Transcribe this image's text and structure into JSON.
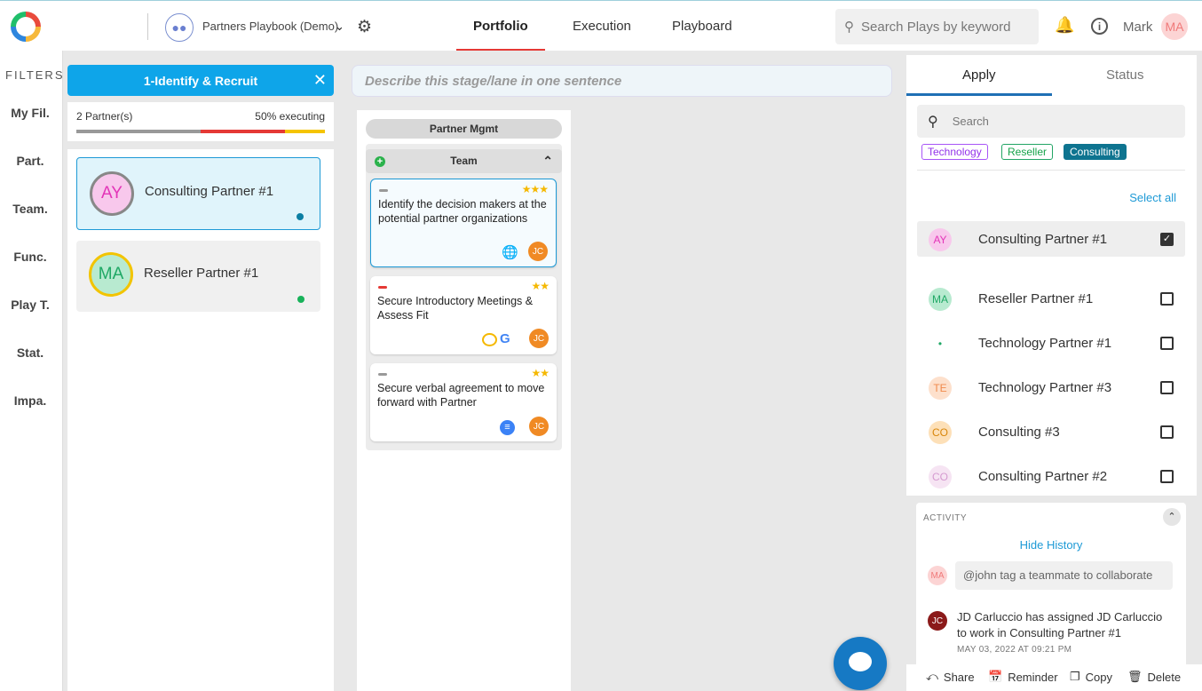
{
  "header": {
    "playbook_name": "Partners Playbook (Demo)",
    "nav": [
      "Portfolio",
      "Execution",
      "Playboard"
    ],
    "search_placeholder": "Search Plays by keyword",
    "username": "Mark",
    "user_initials": "MA"
  },
  "filters": {
    "title": "FILTERS",
    "items": [
      "My Fil.",
      "Part.",
      "Team.",
      "Func.",
      "Play T.",
      "Stat.",
      "Impa."
    ]
  },
  "stage": {
    "title": "1-Identify & Recruit",
    "partners_count": "2 Partner(s)",
    "executing": "50% executing",
    "description_placeholder": "Describe this stage/lane in one sentence"
  },
  "partners": [
    {
      "initials": "AY",
      "name": "Consulting Partner #1",
      "bg": "#f8c8ec",
      "fg": "#e335b8",
      "ring": "#888",
      "dot": "#0b7ea3"
    },
    {
      "initials": "MA",
      "name": "Reseller Partner #1",
      "bg": "#b8ead0",
      "fg": "#1fa865",
      "ring": "#f2c400",
      "dot": "#18b25a"
    }
  ],
  "lane": {
    "title": "Partner Mgmt",
    "team": "Team",
    "plays": [
      {
        "text": "Identify the decision makers at the potential partner organizations",
        "stars": "★★★",
        "flag": "#999",
        "assignee": "JC"
      },
      {
        "text": "Secure Introductory Meetings & Assess Fit",
        "stars": "★★",
        "flag": "#e53935",
        "assignee": "JC"
      },
      {
        "text": "Secure verbal agreement to move forward with Partner",
        "stars": "★★",
        "flag": "#999",
        "assignee": "JC"
      }
    ]
  },
  "panel": {
    "tabs": [
      "Apply",
      "Status"
    ],
    "search_placeholder": "Search",
    "chips": [
      "Technology",
      "Reseller",
      "Consulting"
    ],
    "select_all": "Select all",
    "partners": [
      {
        "initials": "AY",
        "name": "Consulting Partner #1",
        "bg": "#f8c8ec",
        "fg": "#e335b8",
        "checked": true
      },
      {
        "initials": "MA",
        "name": "Reseller Partner #1",
        "bg": "#b8ead0",
        "fg": "#1fa865",
        "checked": false
      },
      {
        "initials": "•",
        "name": "Technology Partner #1",
        "bg": "#ffffff",
        "fg": "#1fa865",
        "checked": false
      },
      {
        "initials": "TE",
        "name": "Technology Partner #3",
        "bg": "#fde0cc",
        "fg": "#f08a4c",
        "checked": false
      },
      {
        "initials": "CO",
        "name": "Consulting #3",
        "bg": "#fde0b8",
        "fg": "#d8860a",
        "checked": false
      },
      {
        "initials": "CO",
        "name": "Consulting Partner #2",
        "bg": "#f6e4f3",
        "fg": "#d59ad0",
        "checked": false
      }
    ]
  },
  "activity": {
    "title": "ACTIVITY",
    "hide_history": "Hide History",
    "input_placeholder": "@john tag a teammate to collaborate",
    "message": "JD Carluccio has assigned JD Carluccio to work in Consulting Partner #1",
    "date": "MAY 03, 2022 AT 09:21 PM",
    "msg_initials": "JC"
  },
  "footer": {
    "share": "Share",
    "reminder": "Reminder",
    "copy": "Copy",
    "delete": "Delete"
  }
}
